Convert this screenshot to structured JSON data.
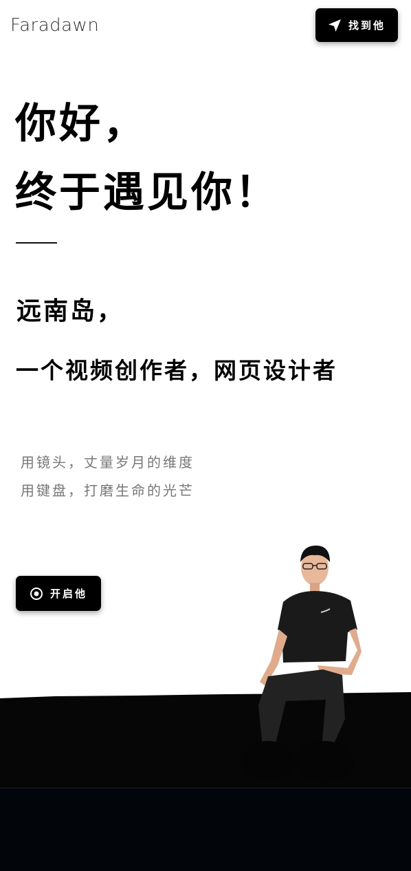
{
  "header": {
    "logo": "Faradawn",
    "find_button_label": "找到他"
  },
  "hero": {
    "title_line_1": "你好，",
    "title_line_2": "终于遇见你！",
    "name": "远南岛，",
    "role": "一个视频创作者，网页设计者",
    "motto_line_1": "用镜头，丈量岁月的维度",
    "motto_line_2": "用键盘，打磨生命的光芒",
    "start_button_label": "开启他"
  },
  "icons": {
    "find": "navigation-arrow-icon",
    "start": "target-circle-icon"
  },
  "colors": {
    "button_bg": "#000000",
    "ground": "#060606",
    "footer": "#02060b",
    "motto_text": "#777777"
  }
}
